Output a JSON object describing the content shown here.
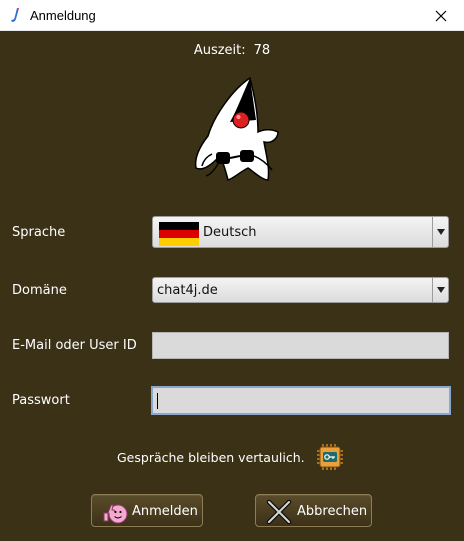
{
  "window": {
    "title": "Anmeldung",
    "icon": "java-icon",
    "close_icon": "close-icon"
  },
  "timeout": {
    "label": "Auszeit:",
    "value": "78"
  },
  "mascot": {
    "icon": "duke-mascot-icon"
  },
  "language": {
    "label": "Sprache",
    "selected": "Deutsch",
    "flag_icon": "german-flag-icon",
    "flag_colors": [
      "#000000",
      "#dd0000",
      "#ffce00"
    ]
  },
  "domain": {
    "label": "Domäne",
    "selected": "chat4j.de"
  },
  "email": {
    "label": "E-Mail oder User ID",
    "value": ""
  },
  "password": {
    "label": "Passwort",
    "value": ""
  },
  "security_note": {
    "text": "Gespräche bleiben vertaulich.",
    "icon": "secure-chip-key-icon"
  },
  "buttons": {
    "login": {
      "label": "Anmelden",
      "icon": "thumbs-up-smiley-icon"
    },
    "cancel": {
      "label": "Abbrechen",
      "icon": "cross-icon"
    }
  },
  "colors": {
    "background": "#3b3116",
    "text": "#ffffff",
    "input_fill": "#dadada",
    "focus_border": "#8ba7cf"
  }
}
